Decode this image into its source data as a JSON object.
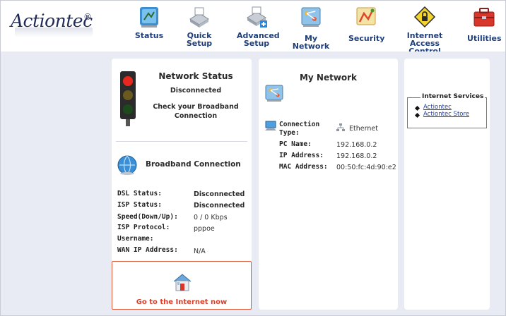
{
  "brand": {
    "logo_text": "Actiontec",
    "reg": "®"
  },
  "nav": [
    {
      "label": "Status"
    },
    {
      "label": "Quick Setup"
    },
    {
      "label": "Advanced Setup"
    },
    {
      "label": "My Network"
    },
    {
      "label": "Security"
    },
    {
      "label": "Internet Access Control"
    },
    {
      "label": "Utilities"
    }
  ],
  "network_status": {
    "title": "Network Status",
    "state": "Disconnected",
    "message": "Check your Broadband Connection"
  },
  "broadband": {
    "title": "Broadband Connection",
    "rows": [
      {
        "label": "DSL Status:",
        "value": "Disconnected"
      },
      {
        "label": "ISP Status:",
        "value": "Disconnected"
      },
      {
        "label": "Speed(Down/Up):",
        "value": "0 / 0 Kbps"
      },
      {
        "label": "ISP Protocol:",
        "value": "pppoe"
      },
      {
        "label": "Username:",
        "value": ""
      },
      {
        "label": "WAN IP Address:",
        "value": "N/A"
      }
    ]
  },
  "go_internet": {
    "label": "Go to the Internet now"
  },
  "my_network": {
    "title": "My Network",
    "connection_type_label": "Connection Type:",
    "connection_type_value": "Ethernet",
    "pc_name_label": "PC Name:",
    "pc_name_value": "192.168.0.2",
    "ip_label": "IP Address:",
    "ip_value": "192.168.0.2",
    "mac_label": "MAC Address:",
    "mac_value": "00:50:fc:4d:90:e2"
  },
  "internet_services": {
    "legend": "Internet Services",
    "links": [
      {
        "label": "Actiontec"
      },
      {
        "label": "Actiontec Store"
      }
    ]
  },
  "colors": {
    "nav_text": "#1f3f7a",
    "background": "#e8ebf3",
    "link_red": "#d8402a",
    "link_blue": "#1f3fa8"
  },
  "icons": [
    "status-icon",
    "quick-setup-icon",
    "advanced-setup-icon",
    "my-network-icon",
    "security-icon",
    "internet-access-control-icon",
    "utilities-icon",
    "traffic-light-icon",
    "globe-icon",
    "network-map-icon",
    "computer-icon",
    "ethernet-icon",
    "house-icon"
  ]
}
